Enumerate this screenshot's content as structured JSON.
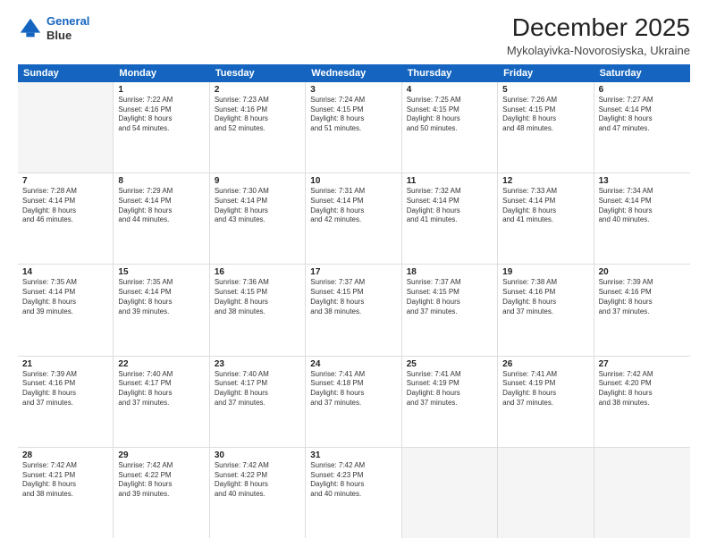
{
  "header": {
    "logo_line1": "General",
    "logo_line2": "Blue",
    "title": "December 2025",
    "subtitle": "Mykolayivka-Novorosiyska, Ukraine"
  },
  "calendar": {
    "days": [
      "Sunday",
      "Monday",
      "Tuesday",
      "Wednesday",
      "Thursday",
      "Friday",
      "Saturday"
    ],
    "rows": [
      [
        {
          "day": "",
          "content": ""
        },
        {
          "day": "1",
          "content": "Sunrise: 7:22 AM\nSunset: 4:16 PM\nDaylight: 8 hours\nand 54 minutes."
        },
        {
          "day": "2",
          "content": "Sunrise: 7:23 AM\nSunset: 4:16 PM\nDaylight: 8 hours\nand 52 minutes."
        },
        {
          "day": "3",
          "content": "Sunrise: 7:24 AM\nSunset: 4:15 PM\nDaylight: 8 hours\nand 51 minutes."
        },
        {
          "day": "4",
          "content": "Sunrise: 7:25 AM\nSunset: 4:15 PM\nDaylight: 8 hours\nand 50 minutes."
        },
        {
          "day": "5",
          "content": "Sunrise: 7:26 AM\nSunset: 4:15 PM\nDaylight: 8 hours\nand 48 minutes."
        },
        {
          "day": "6",
          "content": "Sunrise: 7:27 AM\nSunset: 4:14 PM\nDaylight: 8 hours\nand 47 minutes."
        }
      ],
      [
        {
          "day": "7",
          "content": "Sunrise: 7:28 AM\nSunset: 4:14 PM\nDaylight: 8 hours\nand 46 minutes."
        },
        {
          "day": "8",
          "content": "Sunrise: 7:29 AM\nSunset: 4:14 PM\nDaylight: 8 hours\nand 44 minutes."
        },
        {
          "day": "9",
          "content": "Sunrise: 7:30 AM\nSunset: 4:14 PM\nDaylight: 8 hours\nand 43 minutes."
        },
        {
          "day": "10",
          "content": "Sunrise: 7:31 AM\nSunset: 4:14 PM\nDaylight: 8 hours\nand 42 minutes."
        },
        {
          "day": "11",
          "content": "Sunrise: 7:32 AM\nSunset: 4:14 PM\nDaylight: 8 hours\nand 41 minutes."
        },
        {
          "day": "12",
          "content": "Sunrise: 7:33 AM\nSunset: 4:14 PM\nDaylight: 8 hours\nand 41 minutes."
        },
        {
          "day": "13",
          "content": "Sunrise: 7:34 AM\nSunset: 4:14 PM\nDaylight: 8 hours\nand 40 minutes."
        }
      ],
      [
        {
          "day": "14",
          "content": "Sunrise: 7:35 AM\nSunset: 4:14 PM\nDaylight: 8 hours\nand 39 minutes."
        },
        {
          "day": "15",
          "content": "Sunrise: 7:35 AM\nSunset: 4:14 PM\nDaylight: 8 hours\nand 39 minutes."
        },
        {
          "day": "16",
          "content": "Sunrise: 7:36 AM\nSunset: 4:15 PM\nDaylight: 8 hours\nand 38 minutes."
        },
        {
          "day": "17",
          "content": "Sunrise: 7:37 AM\nSunset: 4:15 PM\nDaylight: 8 hours\nand 38 minutes."
        },
        {
          "day": "18",
          "content": "Sunrise: 7:37 AM\nSunset: 4:15 PM\nDaylight: 8 hours\nand 37 minutes."
        },
        {
          "day": "19",
          "content": "Sunrise: 7:38 AM\nSunset: 4:16 PM\nDaylight: 8 hours\nand 37 minutes."
        },
        {
          "day": "20",
          "content": "Sunrise: 7:39 AM\nSunset: 4:16 PM\nDaylight: 8 hours\nand 37 minutes."
        }
      ],
      [
        {
          "day": "21",
          "content": "Sunrise: 7:39 AM\nSunset: 4:16 PM\nDaylight: 8 hours\nand 37 minutes."
        },
        {
          "day": "22",
          "content": "Sunrise: 7:40 AM\nSunset: 4:17 PM\nDaylight: 8 hours\nand 37 minutes."
        },
        {
          "day": "23",
          "content": "Sunrise: 7:40 AM\nSunset: 4:17 PM\nDaylight: 8 hours\nand 37 minutes."
        },
        {
          "day": "24",
          "content": "Sunrise: 7:41 AM\nSunset: 4:18 PM\nDaylight: 8 hours\nand 37 minutes."
        },
        {
          "day": "25",
          "content": "Sunrise: 7:41 AM\nSunset: 4:19 PM\nDaylight: 8 hours\nand 37 minutes."
        },
        {
          "day": "26",
          "content": "Sunrise: 7:41 AM\nSunset: 4:19 PM\nDaylight: 8 hours\nand 37 minutes."
        },
        {
          "day": "27",
          "content": "Sunrise: 7:42 AM\nSunset: 4:20 PM\nDaylight: 8 hours\nand 38 minutes."
        }
      ],
      [
        {
          "day": "28",
          "content": "Sunrise: 7:42 AM\nSunset: 4:21 PM\nDaylight: 8 hours\nand 38 minutes."
        },
        {
          "day": "29",
          "content": "Sunrise: 7:42 AM\nSunset: 4:22 PM\nDaylight: 8 hours\nand 39 minutes."
        },
        {
          "day": "30",
          "content": "Sunrise: 7:42 AM\nSunset: 4:22 PM\nDaylight: 8 hours\nand 40 minutes."
        },
        {
          "day": "31",
          "content": "Sunrise: 7:42 AM\nSunset: 4:23 PM\nDaylight: 8 hours\nand 40 minutes."
        },
        {
          "day": "",
          "content": ""
        },
        {
          "day": "",
          "content": ""
        },
        {
          "day": "",
          "content": ""
        }
      ]
    ]
  }
}
